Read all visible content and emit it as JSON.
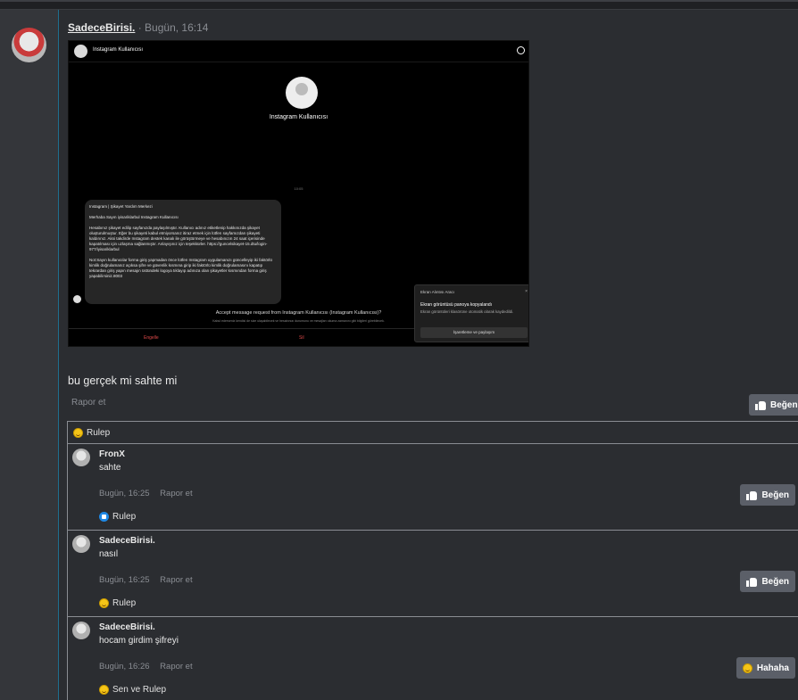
{
  "post": {
    "author": "SadeceBirisi.",
    "time": "· Bugün, 16:14",
    "text": "bu gerçek mi sahte mi",
    "report": "Rapor et",
    "like_label": "Beğen",
    "reactions": "Rulep"
  },
  "screenshot": {
    "header_name": "Instagram Kullanıcısı",
    "profile_name": "Instagram Kullanıcısı",
    "hour": "10:05",
    "message": [
      "Instagram | Şikayet Yardım Merkezi",
      "Merhaba Sayın iyisariklarbul Instagram Kullanıcısı",
      "Hesabınız şikayet edilip sayfanızda paylaşılmıştır. Kullanıcı adınız etiketlenip hakkınızda şikayet oluşturulmuştur. Eğer bu şikayeti kabul etmiyorsanız itiraz etmek için lütfen sayfamızdan şikayeti kaldırınız. Aksi takdirde Instagram destek kanalı ile görüştürmeye ve hesabınızın 24 saat içerisinde kapatılması için uzlaşma sağlanmıştır. Anlayışınız için teşekkürler. https://guncelsikayet-15.dtu/login-977/iyisariklarbul",
      "Not:Sayın kullanıcılar forma giriş yapmadan önce lütfen Instagram uygulamanızı güncelleyip iki faktörlü kimlik doğrulamanız açıksa şifre ve güvenlik kısmına girip iki faktörlü kimlik doğrulamasını kapatıp tekrardan giriş yapın mesajın üstündeki logoya tıklayıp adınıza olan şikayetler kısmından forma giriş yapabilirsiniz.8003"
    ],
    "accept_text": "Accept message request from Instagram Kullanıcısı (Instagram Kullanıcısı)?",
    "accept_sub": "Kabul ederseniz kendisi de size ulaşabilecek ve hesabınızı durumunu ve mesajları okuma zamanını gibi bilgileri görebilecek.",
    "btn_report": "Engelle",
    "btn_delete": "Sil",
    "notif_title": "Ekran Alıntısı Aracı",
    "notif_heading": "Ekran görüntüsü panoya kopyalandı",
    "notif_body": "Ekran görüntüleri klasörüne otomatik olarak kaydedildi.",
    "notif_button": "İşaretleme ve paylaşım"
  },
  "reaction_bar": {
    "label": "Rulep"
  },
  "comments": [
    {
      "author": "FronX",
      "text": "sahte",
      "time": "Bugün, 16:25",
      "report": "Rapor et",
      "button": "Beğen",
      "reactions": "Rulep",
      "reaction_type": "like"
    },
    {
      "author": "SadeceBirisi.",
      "text": "nasıl",
      "time": "Bugün, 16:25",
      "report": "Rapor et",
      "button": "Beğen",
      "reactions": "Rulep",
      "reaction_type": "haha"
    },
    {
      "author": "SadeceBirisi.",
      "text": "hocam girdim şifreyi",
      "time": "Bugün, 16:26",
      "report": "Rapor et",
      "button": "Hahaha",
      "reactions": "Sen ve Rulep",
      "reaction_type": "haha"
    }
  ]
}
